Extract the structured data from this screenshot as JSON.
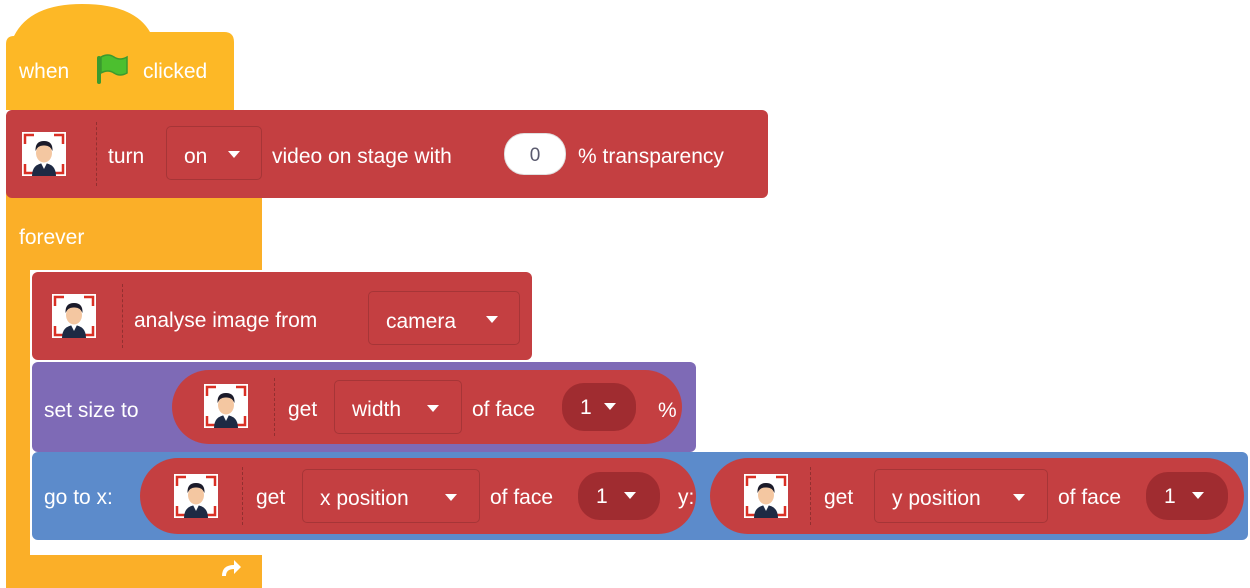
{
  "hat": {
    "when": "when",
    "clicked": "clicked",
    "flag_icon": "green-flag-icon"
  },
  "video_block": {
    "turn": "turn",
    "state": "on",
    "video_on_stage": "video on stage with",
    "transparency_value": "0",
    "transparency_suffix": "% transparency"
  },
  "forever": {
    "label": "forever",
    "loop_icon": "loop-arrow-icon"
  },
  "analyse_block": {
    "label": "analyse image from",
    "source": "camera"
  },
  "size_block": {
    "label": "set size to",
    "get": "get",
    "property": "width",
    "of_face": "of face",
    "face_index": "1",
    "suffix": "%"
  },
  "goto_block": {
    "label": "go to x:",
    "y_label": "y:",
    "x_reporter": {
      "get": "get",
      "property": "x position",
      "of_face": "of face",
      "face_index": "1"
    },
    "y_reporter": {
      "get": "get",
      "property": "y position",
      "of_face": "of face",
      "face_index": "1"
    }
  },
  "colors": {
    "events": "#FDB826",
    "control": "#FBAF28",
    "face_detection": "#C43F41",
    "looks": "#7E6AB6",
    "motion": "#5C8BCB"
  }
}
